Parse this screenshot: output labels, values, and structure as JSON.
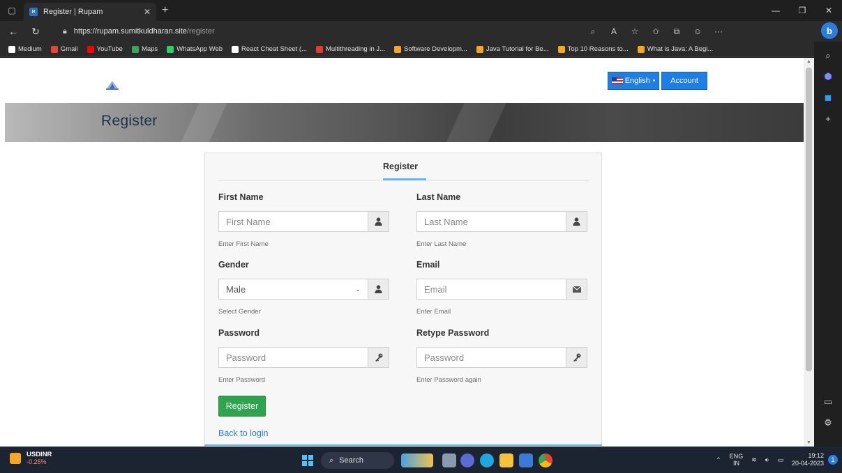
{
  "browser": {
    "tab_title": "Register | Rupam",
    "favicon_text": "R",
    "url_host": "https://rupam.sumitkuldharan.site",
    "url_path": "/register",
    "bookmarks": [
      {
        "label": "Medium",
        "color": "#ffffff"
      },
      {
        "label": "Gmail",
        "color": "#ea4335"
      },
      {
        "label": "YouTube",
        "color": "#ff0000"
      },
      {
        "label": "Maps",
        "color": "#34a853"
      },
      {
        "label": "WhatsApp Web",
        "color": "#25d366"
      },
      {
        "label": "React Cheat Sheet (...",
        "color": "#ffffff"
      },
      {
        "label": "Multithreading in J...",
        "color": "#e53935"
      },
      {
        "label": "Software Developm...",
        "color": "#f5a623"
      },
      {
        "label": "Java Tutorial for Be...",
        "color": "#f5a623"
      },
      {
        "label": "Top 10 Reasons to...",
        "color": "#f5a623"
      },
      {
        "label": "What is Java: A Begi...",
        "color": "#f5a623"
      }
    ]
  },
  "site": {
    "language_label": "English",
    "account_label": "Account",
    "banner_title": "Register"
  },
  "form": {
    "tab_label": "Register",
    "first_name": {
      "label": "First Name",
      "placeholder": "First Name",
      "help": "Enter First Name"
    },
    "last_name": {
      "label": "Last Name",
      "placeholder": "Last Name",
      "help": "Enter Last Name"
    },
    "gender": {
      "label": "Gender",
      "value": "Male",
      "help": "Select Gender"
    },
    "email": {
      "label": "Email",
      "placeholder": "Email",
      "help": "Enter Email"
    },
    "password": {
      "label": "Password",
      "placeholder": "Password",
      "help": "Enter Password"
    },
    "retype_password": {
      "label": "Retype Password",
      "placeholder": "Password",
      "help": "Enter Password again"
    },
    "submit_label": "Register",
    "back_link": "Back to login"
  },
  "taskbar": {
    "ticker_name": "USDINR",
    "ticker_change": "-0.25%",
    "search_label": "Search",
    "lang_top": "ENG",
    "lang_bottom": "IN",
    "time": "19:12",
    "date": "20-04-2023",
    "notifications": "1"
  },
  "colors": {
    "primary": "#1e7ee8",
    "success": "#2ea44f",
    "link": "#2a7de1",
    "tab_accent": "#64b5f6"
  }
}
